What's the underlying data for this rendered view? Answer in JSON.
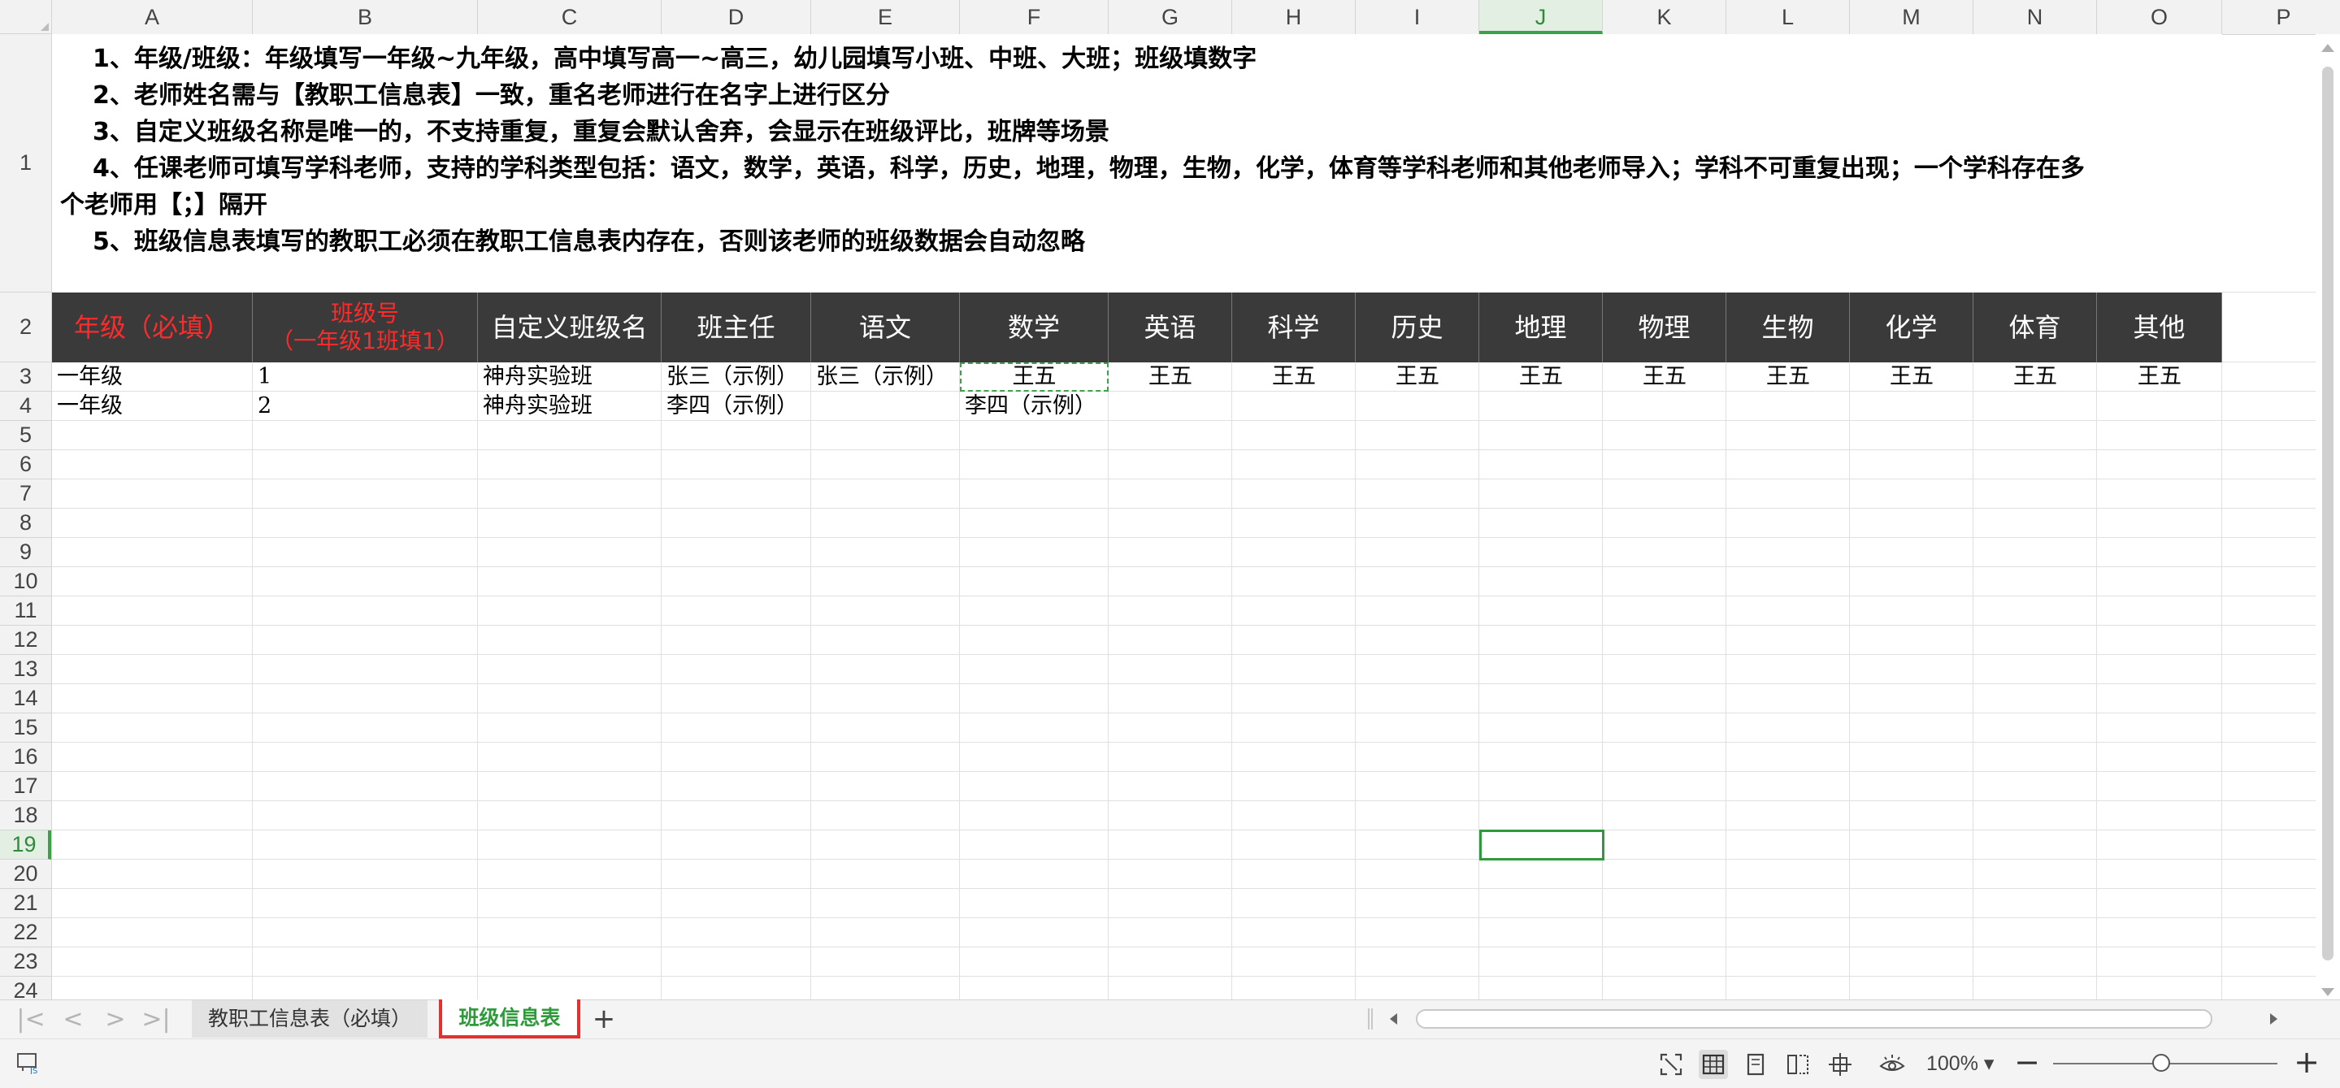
{
  "columns": [
    "A",
    "B",
    "C",
    "D",
    "E",
    "F",
    "G",
    "H",
    "I",
    "J",
    "K",
    "L",
    "M",
    "N",
    "O",
    "P"
  ],
  "selected_column": "J",
  "rows": [
    "1",
    "2",
    "3",
    "4",
    "5",
    "6",
    "7",
    "8",
    "9",
    "10",
    "11",
    "12",
    "13",
    "14",
    "15",
    "16",
    "17",
    "18",
    "19",
    "20",
    "21",
    "22",
    "23",
    "24"
  ],
  "selected_row": "19",
  "notes": [
    "1、年级/班级：年级填写一年级~九年级，高中填写高一~高三，幼儿园填写小班、中班、大班；班级填数字",
    "2、老师姓名需与【教职工信息表】一致，重名老师进行在名字上进行区分",
    "3、自定义班级名称是唯一的，不支持重复，重复会默认舍弃，会显示在班级评比，班牌等场景",
    "4、任课老师可填写学科老师，支持的学科类型包括：语文，数学，英语，科学，历史，地理，物理，生物，化学，体育等学科老师和其他老师导入；学科不可重复出现；一个学科存在多",
    "个老师用【；】隔开",
    "5、班级信息表填写的教职工必须在教职工信息表内存在，否则该老师的班级数据会自动忽略"
  ],
  "header_row": {
    "grade": "年级（必填）",
    "class_no_line1": "班级号",
    "class_no_line2": "（一年级1班填1）",
    "custom_name": "自定义班级名",
    "head_teacher": "班主任",
    "chinese": "语文",
    "math": "数学",
    "english": "英语",
    "science": "科学",
    "history": "历史",
    "geography": "地理",
    "physics": "物理",
    "biology": "生物",
    "chemistry": "化学",
    "pe": "体育",
    "other": "其他"
  },
  "data_rows": [
    {
      "grade": "一年级",
      "class_no": "1",
      "custom_name": "神舟实验班",
      "head_teacher": "张三（示例）",
      "chinese": "张三（示例）",
      "math": "王五",
      "english": "王五",
      "science": "王五",
      "history": "王五",
      "geography": "王五",
      "physics": "王五",
      "biology": "王五",
      "chemistry": "王五",
      "pe": "王五",
      "other": "王五"
    },
    {
      "grade": "一年级",
      "class_no": "2",
      "custom_name": "神舟实验班",
      "head_teacher": "李四（示例）",
      "chinese": "",
      "math": "李四（示例）",
      "english": "",
      "science": "",
      "history": "",
      "geography": "",
      "physics": "",
      "biology": "",
      "chemistry": "",
      "pe": "",
      "other": ""
    }
  ],
  "sheet_tabs": [
    {
      "label": "教职工信息表（必填）",
      "active": false
    },
    {
      "label": "班级信息表",
      "active": true
    }
  ],
  "add_sheet_label": "+",
  "nav_buttons": {
    "first": "|<",
    "prev": "<",
    "next": ">",
    "last": ">|"
  },
  "status": {
    "zoom": "100%",
    "zoom_level": 1.0,
    "zoom_minus": "−",
    "zoom_plus": "+"
  },
  "colors": {
    "header_bg": "#3a3a3a",
    "required_text": "#ff2a2a",
    "selection_green": "#2f9a3c",
    "active_tab_outline": "#e53030"
  },
  "icons": {
    "status_left": "macro-js-icon",
    "status_right": [
      "fullscreen-icon",
      "normal-view-icon",
      "page-view-icon",
      "page-break-icon",
      "crosshair-icon",
      "eye-protection-icon"
    ]
  }
}
